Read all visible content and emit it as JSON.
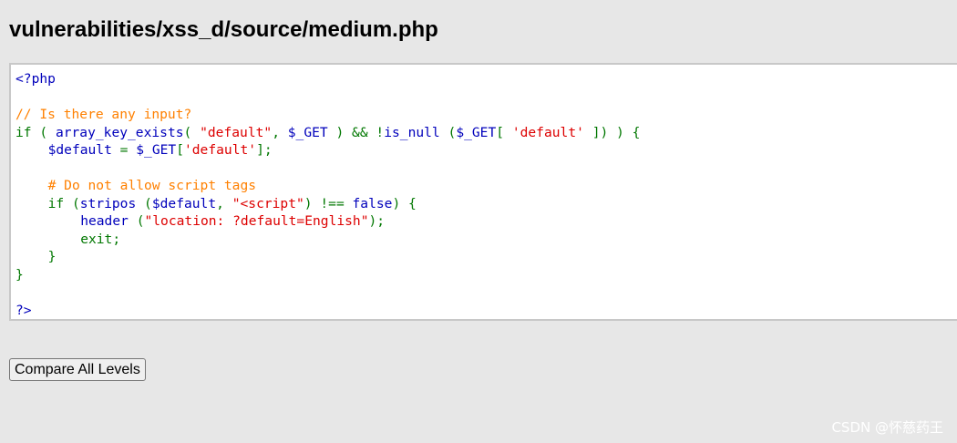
{
  "page": {
    "title": "vulnerabilities/xss_d/source/medium.php"
  },
  "code": {
    "l1": "<?php",
    "l3": "// Is there any input?",
    "l4_if": "if ( ",
    "l4_fn": "array_key_exists",
    "l4_p": "( ",
    "l4_str": "\"default\"",
    "l4_c": ", ",
    "l4_var": "$_GET",
    "l4_rest": " ) && !",
    "l4_fn2": "is_null",
    "l4_p2": " (",
    "l4_var2": "$_GET",
    "l4_b": "[ ",
    "l4_str2": "'default'",
    "l4_end": " ]) ) {",
    "l5_var": "$default",
    "l5_eq": " = ",
    "l5_var2": "$_GET",
    "l5_b": "[",
    "l5_str": "'default'",
    "l5_end": "];",
    "l7": "# Do not allow script tags",
    "l8_if": "if (",
    "l8_fn": "stripos",
    "l8_p": " (",
    "l8_var": "$default",
    "l8_c": ", ",
    "l8_str": "\"<script\"",
    "l8_p2": ") !== ",
    "l8_false": "false",
    "l8_end": ") {",
    "l9_fn": "header",
    "l9_p": " (",
    "l9_str": "\"location: ?default=English\"",
    "l9_end": ");",
    "l10": "exit;",
    "l11": "}",
    "l12": "}",
    "l14": "?>"
  },
  "buttons": {
    "compare_label": "Compare All Levels"
  },
  "watermark": "CSDN @怀慈药王",
  "colors": {
    "keyword": "#007700",
    "default": "#0000bb",
    "comment": "#ff8000",
    "string": "#dd0000"
  }
}
